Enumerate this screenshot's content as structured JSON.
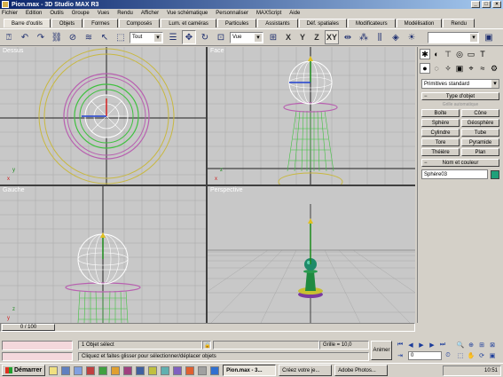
{
  "window": {
    "title": "Pion.max - 3D Studio MAX R3"
  },
  "menu": [
    "Fichier",
    "Edition",
    "Outils",
    "Groupe",
    "Vues",
    "Rendu",
    "Afficher",
    "Vue schématique",
    "Personnaliser",
    "MAXScript",
    "Aide"
  ],
  "tabs": [
    {
      "label": "Barre d'outils",
      "active": true
    },
    {
      "label": "Objets"
    },
    {
      "label": "Formes"
    },
    {
      "label": "Composés"
    },
    {
      "label": "Lum. et caméras"
    },
    {
      "label": "Particules"
    },
    {
      "label": "Assistants"
    },
    {
      "label": "Déf. spatiales"
    },
    {
      "label": "Modificateurs"
    },
    {
      "label": "Modélisation"
    },
    {
      "label": "Rendu"
    }
  ],
  "toolbar": {
    "selection_filter": "Tout",
    "ref_coord": "Vue",
    "axis_x": "X",
    "axis_y": "Y",
    "axis_z": "Z",
    "axis_xy": "XY",
    "named_sel": ""
  },
  "viewports": {
    "top": "Dessus",
    "front": "Face",
    "left": "Gauche",
    "perspective": "Perspective"
  },
  "command_panel": {
    "category": "Primitives standard",
    "object_type_title": "Type d'objet",
    "autogrid": "Grille automatique",
    "buttons": [
      "Boîte",
      "Cône",
      "Sphère",
      "Géosphère",
      "Cylindre",
      "Tube",
      "Tore",
      "Pyramide",
      "Théière",
      "Plan"
    ],
    "name_color_title": "Nom et couleur",
    "object_name": "Sphère03",
    "object_color": "#1fa07a"
  },
  "timeline": {
    "position": "0 / 100"
  },
  "status": {
    "selection": "1 Objet sélect",
    "prompt": "Cliquez et faites glisser pour sélectionner/déplacer objets",
    "grid": "Grille = 10,0",
    "animate": "Animer",
    "frame": "0"
  },
  "taskbar": {
    "start": "Démarrer",
    "tasks": [
      {
        "label": "Pion.max - 3...",
        "active": true
      },
      {
        "label": "Créez votre je..."
      },
      {
        "label": "Adobe Photos..."
      }
    ],
    "clock": "10:51"
  }
}
